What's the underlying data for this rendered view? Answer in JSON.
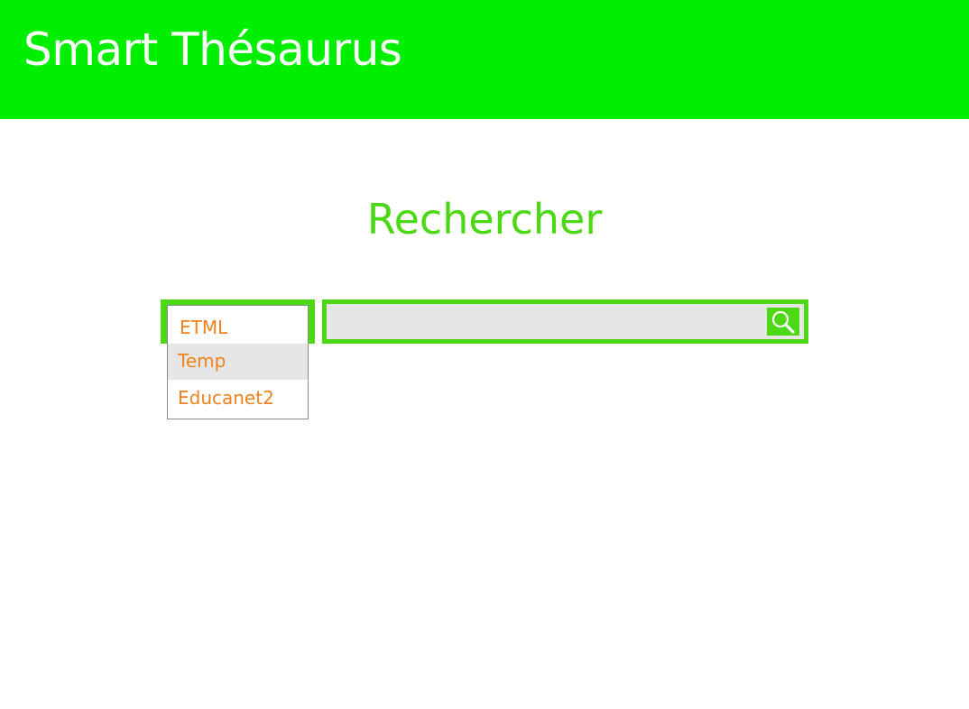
{
  "header": {
    "title": "Smart Thésaurus",
    "background_color": "#00ee00"
  },
  "main": {
    "heading": "Rechercher",
    "accent_color": "#4cd814"
  },
  "source_select": {
    "options": [
      "ETML",
      "Temp",
      "Educanet2"
    ],
    "highlighted_option": "Temp",
    "option_color": "#f0821e"
  },
  "search": {
    "value": "",
    "placeholder": "",
    "button_icon": "search-icon"
  }
}
